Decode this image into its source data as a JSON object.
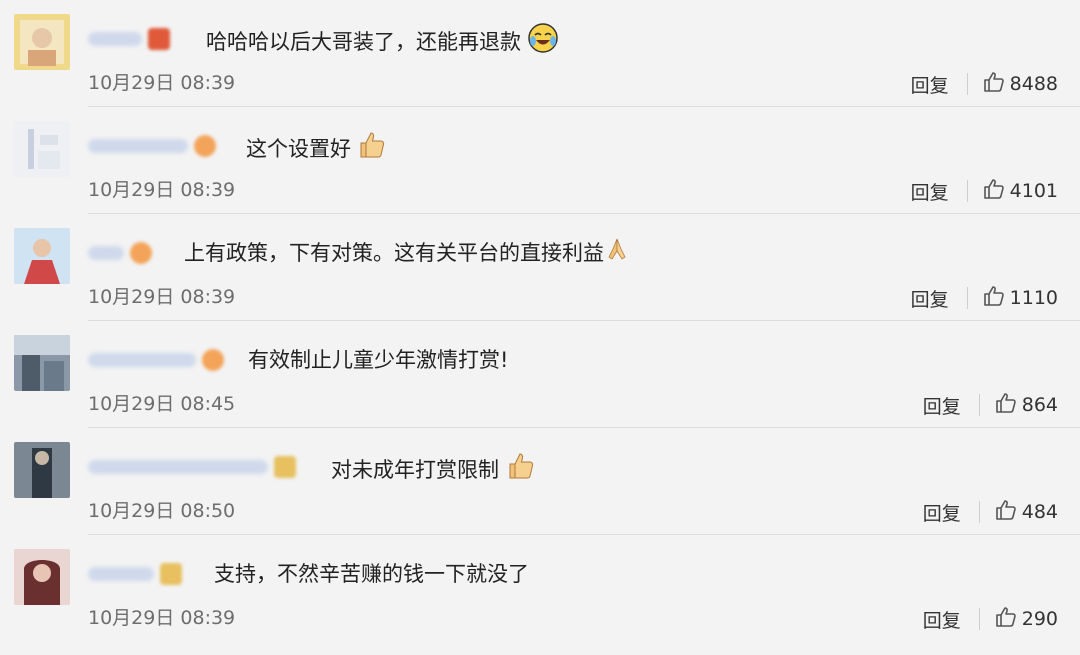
{
  "comments": [
    {
      "text": "哈哈哈以后大哥装了，还能再退款",
      "time": "10月29日 08:39",
      "reply_label": "回复",
      "likes": "8488",
      "emoji": "laughing-crying-icon",
      "avatar_color": "#e8c86a",
      "badge_color": "#e05a3a"
    },
    {
      "text": "这个设置好",
      "time": "10月29日 08:39",
      "reply_label": "回复",
      "likes": "4101",
      "emoji": "thumbs-up-icon",
      "avatar_color": "#c8d0e0",
      "badge_color": "#f3a45a"
    },
    {
      "text": "上有政策，下有对策。这有关平台的直接利益",
      "time": "10月29日 08:39",
      "reply_label": "回复",
      "likes": "1110",
      "emoji": "folded-hands-icon",
      "avatar_color": "#d66060",
      "badge_color": "#f3a45a"
    },
    {
      "text": "有效制止儿童少年激情打赏!",
      "time": "10月29日 08:45",
      "reply_label": "回复",
      "likes": "864",
      "emoji": "",
      "avatar_color": "#6a7a8a",
      "badge_color": "#f3a45a"
    },
    {
      "text": "对未成年打赏限制",
      "time": "10月29日 08:50",
      "reply_label": "回复",
      "likes": "484",
      "emoji": "thumbs-up-icon",
      "avatar_color": "#4a5a6a",
      "badge_color": "#e8c060"
    },
    {
      "text": "支持，不然辛苦赚的钱一下就没了",
      "time": "10月29日 08:39",
      "reply_label": "回复",
      "likes": "290",
      "emoji": "",
      "avatar_color": "#8a4a4a",
      "badge_color": "#e8c060"
    }
  ]
}
